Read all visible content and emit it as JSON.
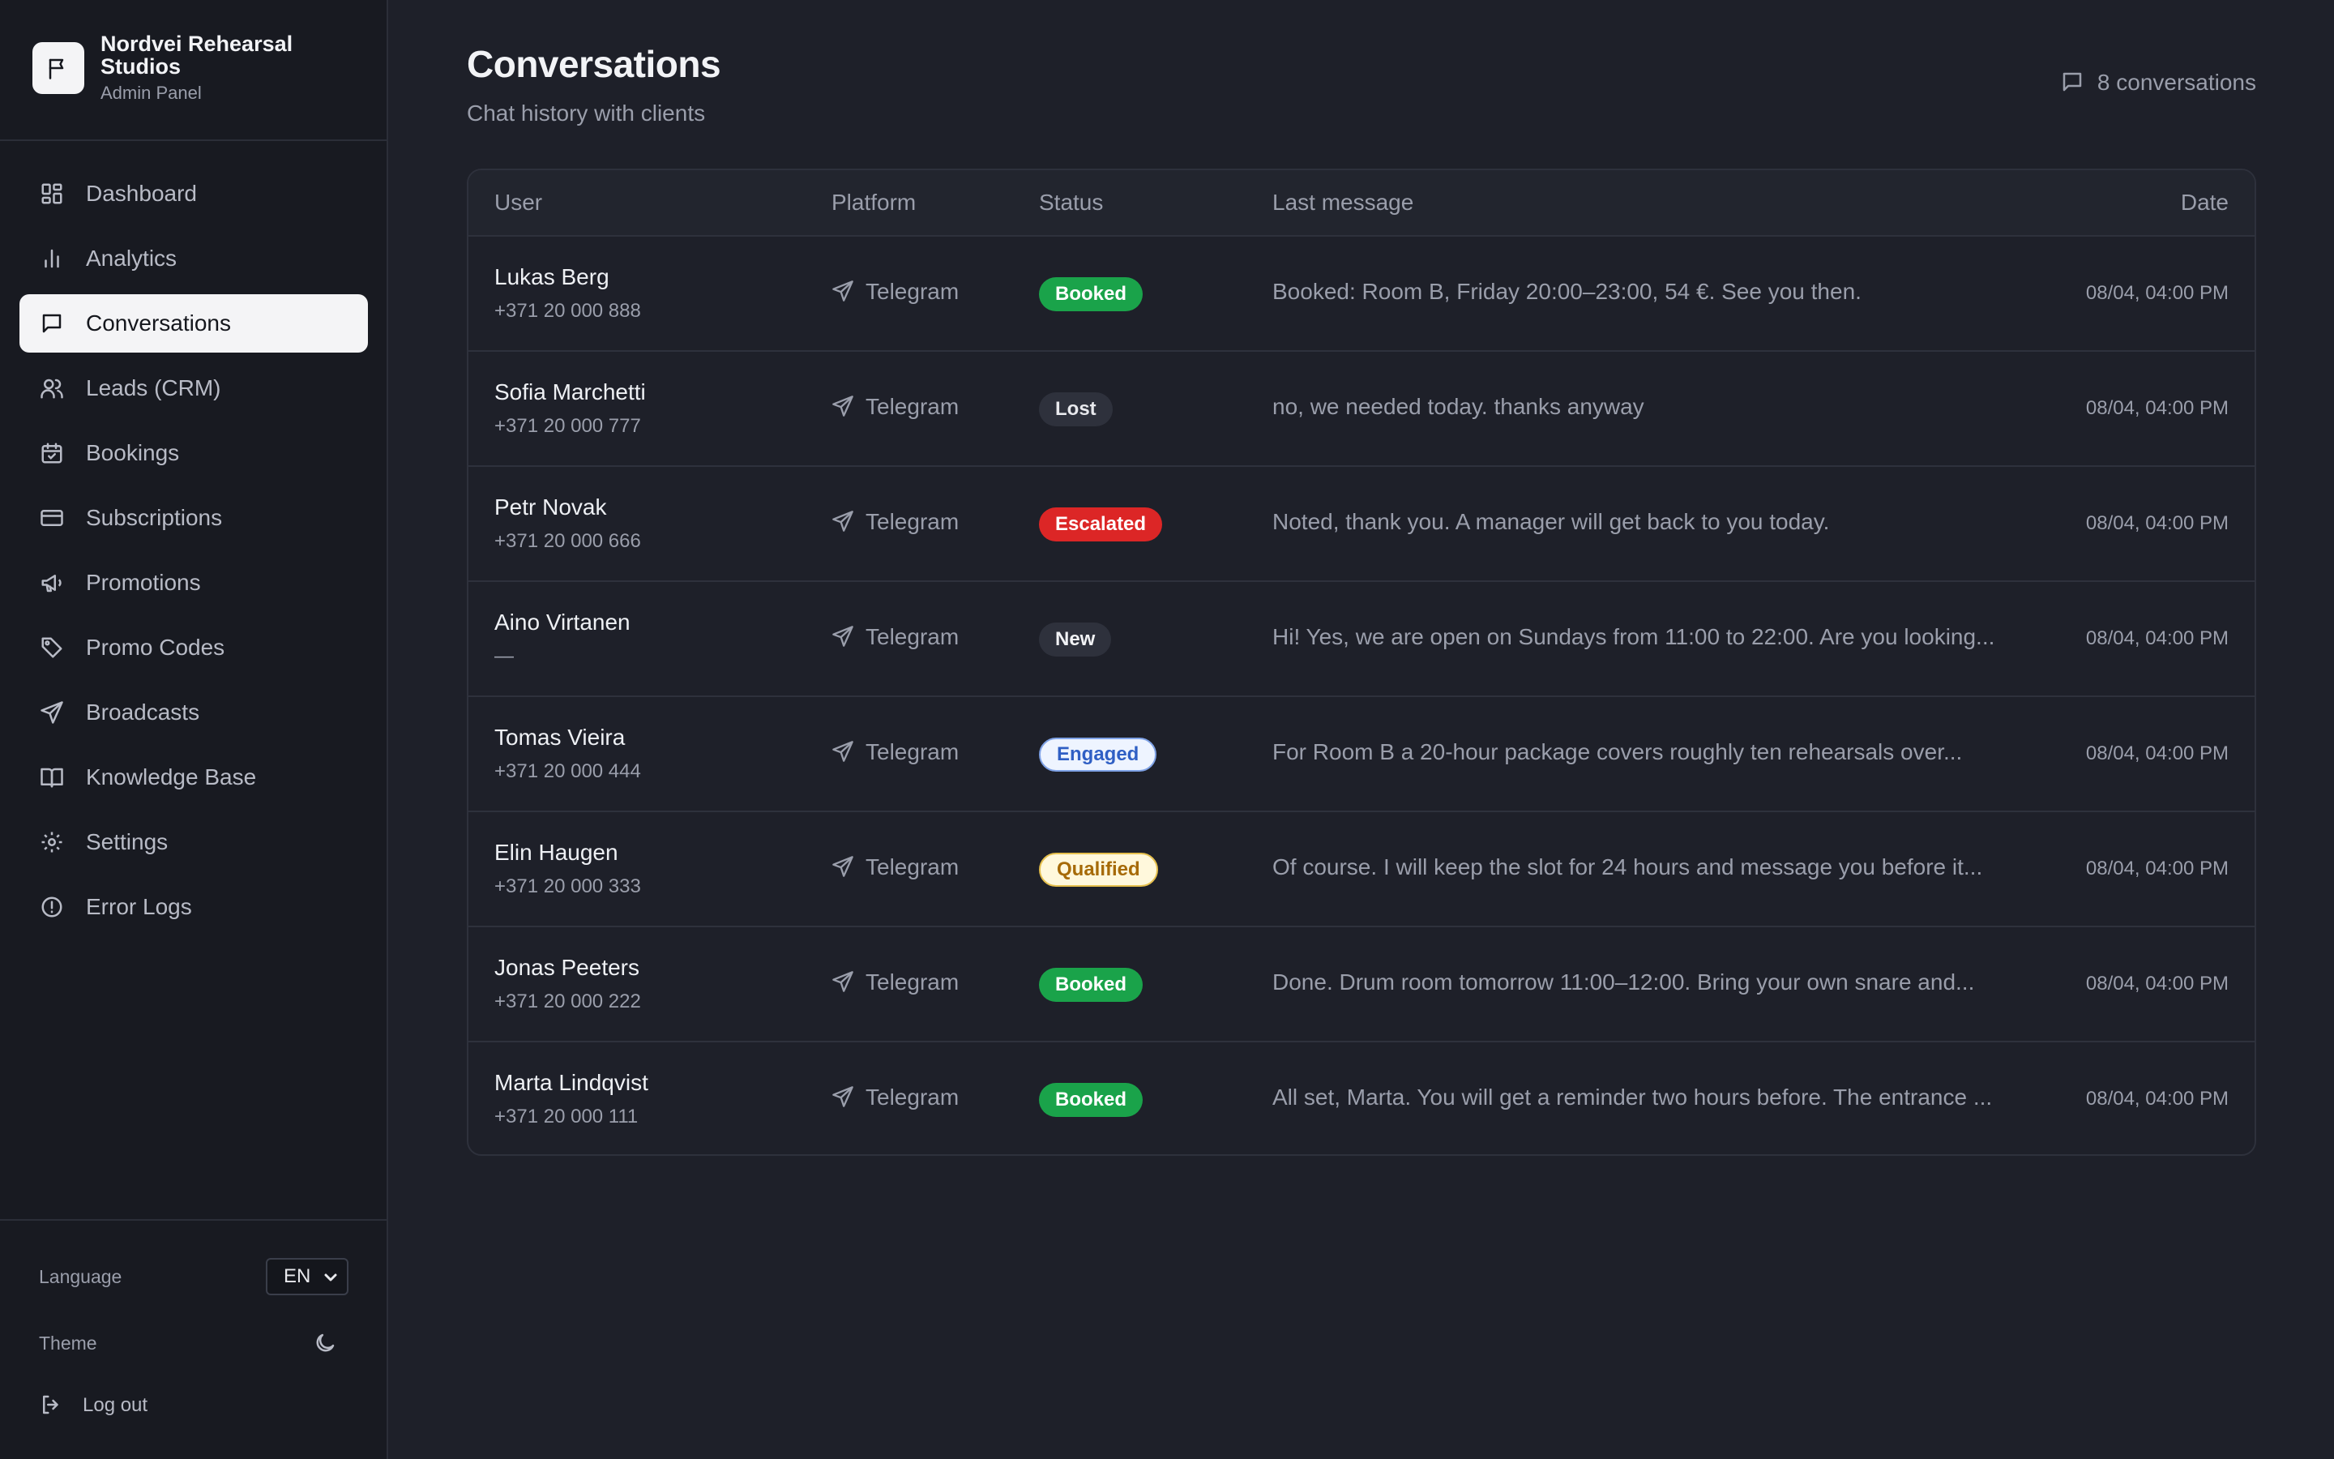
{
  "app": {
    "name": "Nordvei Rehearsal Studios",
    "subtitle": "Admin Panel"
  },
  "sidebar": {
    "items": [
      {
        "label": "Dashboard",
        "icon": "dashboard-icon",
        "active": false
      },
      {
        "label": "Analytics",
        "icon": "bar-chart-icon",
        "active": false
      },
      {
        "label": "Conversations",
        "icon": "chat-icon",
        "active": true
      },
      {
        "label": "Leads (CRM)",
        "icon": "users-icon",
        "active": false
      },
      {
        "label": "Bookings",
        "icon": "calendar-icon",
        "active": false
      },
      {
        "label": "Subscriptions",
        "icon": "credit-card-icon",
        "active": false
      },
      {
        "label": "Promotions",
        "icon": "megaphone-icon",
        "active": false
      },
      {
        "label": "Promo Codes",
        "icon": "tag-icon",
        "active": false
      },
      {
        "label": "Broadcasts",
        "icon": "send-icon",
        "active": false
      },
      {
        "label": "Knowledge Base",
        "icon": "book-icon",
        "active": false
      },
      {
        "label": "Settings",
        "icon": "gear-icon",
        "active": false
      },
      {
        "label": "Error Logs",
        "icon": "alert-circle-icon",
        "active": false
      }
    ],
    "language_label": "Language",
    "language_value": "EN",
    "theme_label": "Theme",
    "logout_label": "Log out"
  },
  "header": {
    "title": "Conversations",
    "subtitle": "Chat history with clients",
    "count_text": "8 conversations"
  },
  "table": {
    "columns": {
      "user": "User",
      "platform": "Platform",
      "status": "Status",
      "last_message": "Last message",
      "date": "Date"
    },
    "rows": [
      {
        "name": "Lukas Berg",
        "phone": "+371 20 000 888",
        "platform": "Telegram",
        "status": "Booked",
        "status_kind": "booked",
        "message": "Booked: Room B, Friday 20:00–23:00, 54 €. See you then.",
        "date": "08/04, 04:00 PM"
      },
      {
        "name": "Sofia Marchetti",
        "phone": "+371 20 000 777",
        "platform": "Telegram",
        "status": "Lost",
        "status_kind": "lost",
        "message": "no, we needed today. thanks anyway",
        "date": "08/04, 04:00 PM"
      },
      {
        "name": "Petr Novak",
        "phone": "+371 20 000 666",
        "platform": "Telegram",
        "status": "Escalated",
        "status_kind": "escalated",
        "message": "Noted, thank you. A manager will get back to you today.",
        "date": "08/04, 04:00 PM"
      },
      {
        "name": "Aino Virtanen",
        "phone": "—",
        "platform": "Telegram",
        "status": "New",
        "status_kind": "new",
        "message": "Hi! Yes, we are open on Sundays from 11:00 to 22:00. Are you looking...",
        "date": "08/04, 04:00 PM"
      },
      {
        "name": "Tomas Vieira",
        "phone": "+371 20 000 444",
        "platform": "Telegram",
        "status": "Engaged",
        "status_kind": "engaged",
        "message": "For Room B a 20-hour package covers roughly ten rehearsals over...",
        "date": "08/04, 04:00 PM"
      },
      {
        "name": "Elin Haugen",
        "phone": "+371 20 000 333",
        "platform": "Telegram",
        "status": "Qualified",
        "status_kind": "qualified",
        "message": "Of course. I will keep the slot for 24 hours and message you before it...",
        "date": "08/04, 04:00 PM"
      },
      {
        "name": "Jonas Peeters",
        "phone": "+371 20 000 222",
        "platform": "Telegram",
        "status": "Booked",
        "status_kind": "booked",
        "message": "Done. Drum room tomorrow 11:00–12:00. Bring your own snare and...",
        "date": "08/04, 04:00 PM"
      },
      {
        "name": "Marta Lindqvist",
        "phone": "+371 20 000 111",
        "platform": "Telegram",
        "status": "Booked",
        "status_kind": "booked",
        "message": "All set, Marta. You will get a reminder two hours before. The entrance ...",
        "date": "08/04, 04:00 PM"
      }
    ]
  },
  "colors": {
    "background": "#1e2029",
    "sidebar": "#181a21",
    "booked": "#1aa34a",
    "escalated": "#dc2626",
    "engaged": "#2f5fc4",
    "qualified": "#a66a07"
  }
}
